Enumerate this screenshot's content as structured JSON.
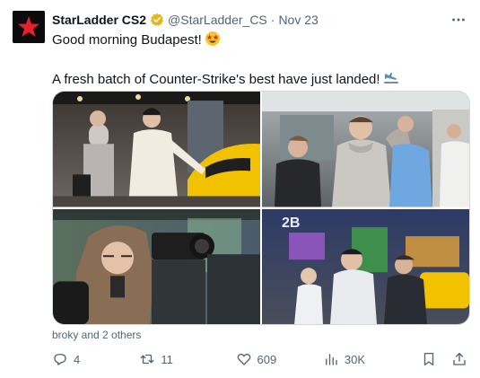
{
  "tweet": {
    "display_name": "StarLadder CS2",
    "handle": "@StarLadder_CS",
    "separator": "·",
    "date": "Nov 23",
    "line1": "Good morning Budapest!",
    "line2": "A fresh batch of Counter-Strike's best have just landed!",
    "liked_by": "broky and 2 others"
  },
  "icons": {
    "verified": "verified-badge-icon",
    "more": "more-options-icon",
    "emoji1": "star-struck-emoji",
    "emoji2": "airplane-landing-emoji",
    "reply": "reply-icon",
    "retweet": "retweet-icon",
    "like": "heart-icon",
    "views": "views-chart-icon",
    "bookmark": "bookmark-icon",
    "share": "share-icon"
  },
  "stats": {
    "replies": "4",
    "retweets": "11",
    "likes": "609",
    "views": "30K"
  },
  "colors": {
    "text": "#0f1419",
    "muted": "#536471",
    "verified_gold": "#e2b719",
    "brand_red": "#e4202a"
  }
}
